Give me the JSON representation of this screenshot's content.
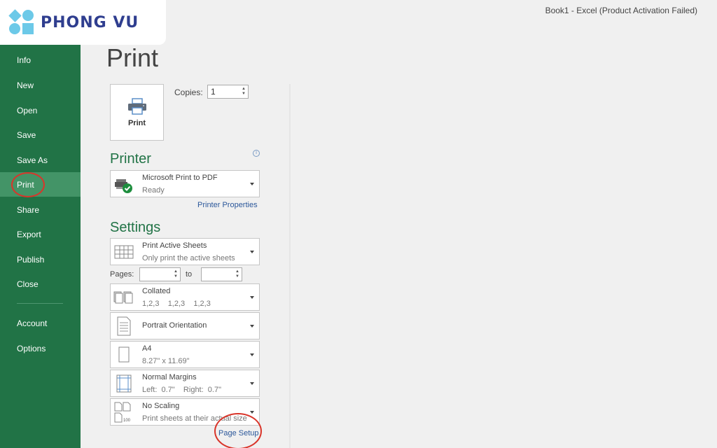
{
  "logo": {
    "text": "PHONG VU"
  },
  "window_title": "Book1 - Excel (Product Activation Failed)",
  "sidebar": {
    "items": [
      {
        "label": "Info"
      },
      {
        "label": "New"
      },
      {
        "label": "Open"
      },
      {
        "label": "Save"
      },
      {
        "label": "Save As"
      },
      {
        "label": "Print",
        "active": true
      },
      {
        "label": "Share"
      },
      {
        "label": "Export"
      },
      {
        "label": "Publish"
      },
      {
        "label": "Close"
      },
      {
        "label": "Account"
      },
      {
        "label": "Options"
      }
    ]
  },
  "page_title": "Print",
  "print_button": {
    "label": "Print",
    "icon": "printer-icon"
  },
  "copies": {
    "label": "Copies:",
    "value": "1"
  },
  "printer": {
    "section_title": "Printer",
    "info_icon": "info-icon",
    "name": "Microsoft Print to PDF",
    "status": "Ready",
    "properties_link": "Printer Properties"
  },
  "settings": {
    "section_title": "Settings",
    "print_what": {
      "main": "Print Active Sheets",
      "sub": "Only print the active sheets"
    },
    "pages": {
      "label": "Pages:",
      "from": "",
      "to_label": "to",
      "to": ""
    },
    "collation": {
      "main": "Collated",
      "sub": "1,2,3    1,2,3    1,2,3"
    },
    "orientation": {
      "main": "Portrait Orientation"
    },
    "paper": {
      "main": "A4",
      "sub": "8.27\" x 11.69\""
    },
    "margins": {
      "main": "Normal Margins",
      "sub": "Left:  0.7\"    Right:  0.7\""
    },
    "scaling": {
      "main": "No Scaling",
      "sub": "Print sheets at their actual size",
      "icon_text": "100"
    },
    "page_setup_link": "Page Setup"
  },
  "colors": {
    "sidebar_bg": "#217346",
    "sidebar_active": "#439467",
    "section_title": "#217346",
    "link": "#2b579a",
    "annotation": "#d9352a",
    "logo_text": "#2f3e8f",
    "logo_mark": "#6cc9e8"
  }
}
